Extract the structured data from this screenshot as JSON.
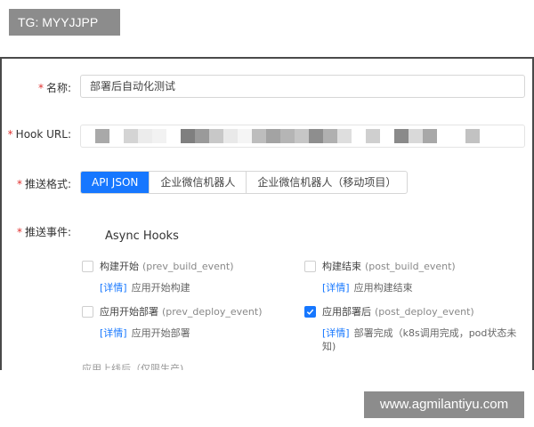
{
  "watermarks": {
    "top_tag": "TG: MYYJJPP",
    "bottom_site": "www.agmilantiyu.com"
  },
  "form": {
    "name": {
      "required_mark": "*",
      "label": "名称:",
      "value": "部署后自动化测试"
    },
    "hook_url": {
      "required_mark": "*",
      "label": "Hook URL:"
    },
    "format": {
      "required_mark": "*",
      "label": "推送格式:",
      "options": [
        "API JSON",
        "企业微信机器人",
        "企业微信机器人（移动项目）"
      ],
      "selected_index": 0
    },
    "events": {
      "required_mark": "*",
      "label": "推送事件:",
      "section_title": "Async Hooks",
      "items": [
        {
          "name": "构建开始",
          "event": "(prev_build_event)",
          "detail_link": "[详情]",
          "desc": "应用开始构建",
          "checked": false
        },
        {
          "name": "构建结束",
          "event": "(post_build_event)",
          "detail_link": "[详情]",
          "desc": "应用构建结束",
          "checked": false
        },
        {
          "name": "应用开始部署",
          "event": "(prev_deploy_event)",
          "detail_link": "[详情]",
          "desc": "应用开始部署",
          "checked": false
        },
        {
          "name": "应用部署后",
          "event": "(post_deploy_event)",
          "detail_link": "[详情]",
          "desc": "部署完成（k8s调用完成，pod状态未知)",
          "checked": true
        }
      ],
      "cutoff_text": "应用上线后（仅限生产)"
    }
  },
  "colors": {
    "accent": "#1677ff",
    "required": "#e0312f"
  }
}
